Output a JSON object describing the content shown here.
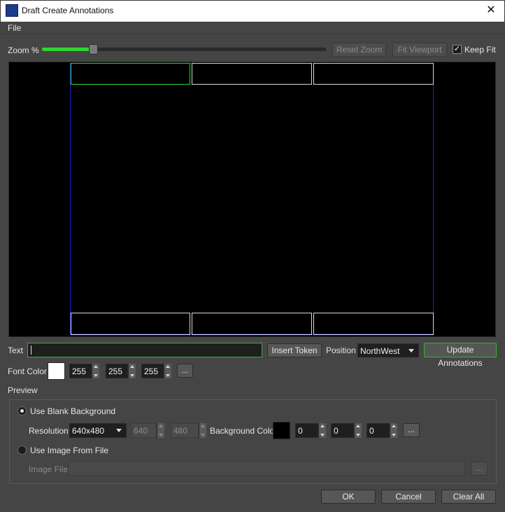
{
  "window": {
    "title": "Draft Create Annotations",
    "close_glyph": "✕"
  },
  "menu": {
    "file": "File"
  },
  "zoom": {
    "label": "Zoom %",
    "level": 0.18,
    "reset_zoom": "Reset Zoom",
    "fit_viewport": "Fit Viewport",
    "keep_fit_label": "Keep Fit",
    "keep_fit_checked": true
  },
  "annotation": {
    "text_label": "Text",
    "text_value": "",
    "insert_token": "Insert Token",
    "position_label": "Position",
    "position_value": "NorthWest",
    "update": "Update Annotations",
    "font_color_label": "Font Color",
    "font_color": {
      "r": "255",
      "g": "255",
      "b": "255",
      "swatch": "#ffffff"
    },
    "more": "..."
  },
  "preview": {
    "title": "Preview",
    "use_blank_background": "Use Blank Background",
    "resolution_label": "Resolution",
    "resolution_value": "640x480",
    "width": "640",
    "height": "480",
    "background_color_label": "Background Color",
    "background_color": {
      "r": "0",
      "g": "0",
      "b": "0",
      "swatch": "#000000"
    },
    "more": "...",
    "use_image_from_file": "Use Image From File",
    "image_file_label": "Image File",
    "image_file_value": "",
    "browse": "..."
  },
  "footer": {
    "ok": "OK",
    "cancel": "Cancel",
    "clear_all": "Clear All"
  },
  "colors": {
    "accent_green": "#2fd42f",
    "canvas_border": "#1f25c8"
  }
}
